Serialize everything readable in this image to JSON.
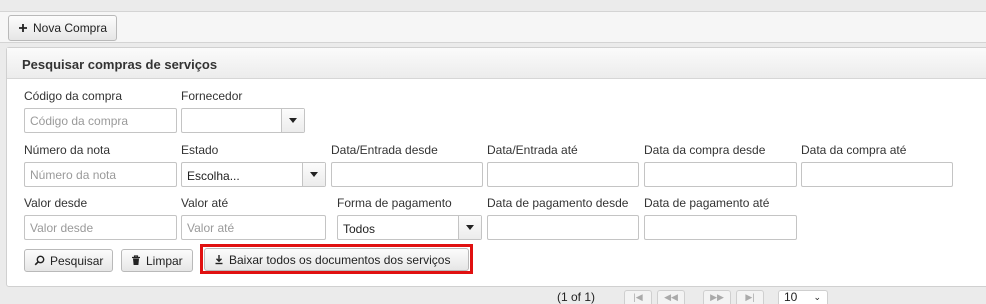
{
  "toolbar": {
    "new_purchase_label": "Nova Compra"
  },
  "search_panel": {
    "title": "Pesquisar compras de serviços",
    "fields": {
      "codigo": {
        "label": "Código da compra",
        "placeholder": "Código da compra"
      },
      "fornecedor": {
        "label": "Fornecedor",
        "value": ""
      },
      "numero_nota": {
        "label": "Número da nota",
        "placeholder": "Número da nota"
      },
      "estado": {
        "label": "Estado",
        "value": "Escolha..."
      },
      "entrada_desde": {
        "label": "Data/Entrada desde"
      },
      "entrada_ate": {
        "label": "Data/Entrada até"
      },
      "compra_desde": {
        "label": "Data da compra desde"
      },
      "compra_ate": {
        "label": "Data da compra até"
      },
      "valor_desde": {
        "label": "Valor desde",
        "placeholder": "Valor desde"
      },
      "valor_ate": {
        "label": "Valor até",
        "placeholder": "Valor até"
      },
      "forma_pagamento": {
        "label": "Forma de pagamento",
        "value": "Todos"
      },
      "pagamento_desde": {
        "label": "Data de pagamento desde"
      },
      "pagamento_ate": {
        "label": "Data de pagamento até"
      }
    },
    "actions": {
      "search_label": "Pesquisar",
      "clear_label": "Limpar",
      "download_label": "Baixar todos os documentos dos serviços"
    }
  },
  "pagination": {
    "report": "(1 of 1)",
    "rows_per_page": "10"
  },
  "colors": {
    "highlight": "#e01010"
  }
}
